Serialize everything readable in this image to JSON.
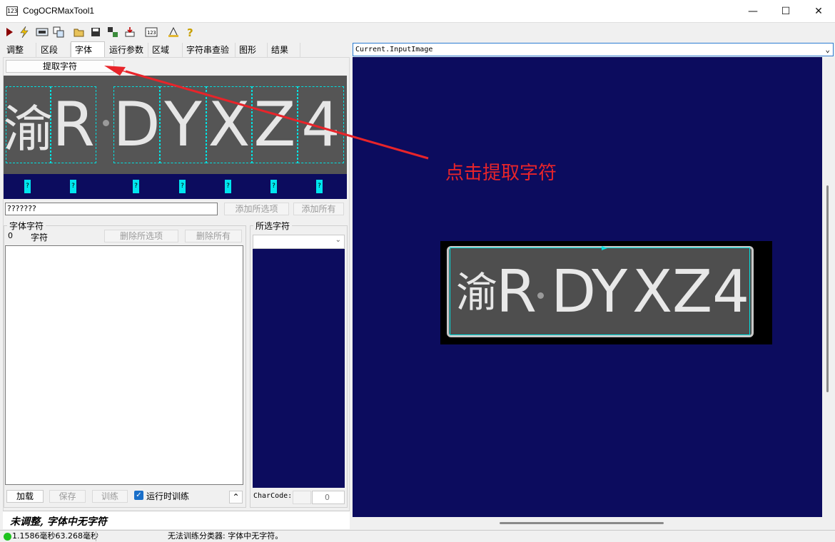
{
  "window": {
    "title": "CogOCRMaxTool1",
    "app_icon_text": "123",
    "minimize_glyph": "—",
    "maximize_glyph": "☐",
    "close_glyph": "✕"
  },
  "toolbar": {
    "icons": [
      "run-icon",
      "electric-icon",
      "image-icon",
      "local-image-icon",
      "open-icon",
      "save-icon",
      "reset-icon",
      "import-icon",
      "numeric-icon",
      "measure-icon",
      "help-icon"
    ]
  },
  "tabs": [
    "调整",
    "区段",
    "字体",
    "运行参数",
    "区域",
    "字符串查验",
    "图形",
    "结果"
  ],
  "active_tab": "字体",
  "font_tab": {
    "extract_button": "提取字符",
    "segmented_chars": [
      "渝",
      "R",
      "D",
      "Y",
      "X",
      "Z",
      "4"
    ],
    "unknown_labels": [
      "?",
      "?",
      "?",
      "?",
      "?",
      "?",
      "?"
    ],
    "pattern_input_value": "???????",
    "add_selected_button": "添加所选项",
    "add_all_button": "添加所有",
    "font_chars_group": {
      "title": "字体字符",
      "count": "0",
      "column_header": "字符",
      "delete_selected_button": "删除所选项",
      "delete_all_button": "删除所有"
    },
    "selected_chars_group": {
      "title": "所选字符",
      "charcode_label": "CharCode:",
      "charcode_value": "0"
    },
    "load_button": "加载",
    "save_button": "保存",
    "train_button": "训练",
    "runtime_train_label": "运行时训练",
    "runtime_train_checked": true,
    "collapse_glyph": "⌃"
  },
  "message": "未调整, 字体中无字符",
  "status": {
    "timing": "1.1586毫秒63.268毫秒",
    "message": "无法训练分类器: 字体中无字符。"
  },
  "display": {
    "image_selector": "Current.InputImage",
    "plate_chars": [
      "渝",
      "R",
      "D",
      "Y",
      "X",
      "Z",
      "4"
    ]
  },
  "annotation": {
    "text": "点击提取字符",
    "color": "#e8242a"
  }
}
